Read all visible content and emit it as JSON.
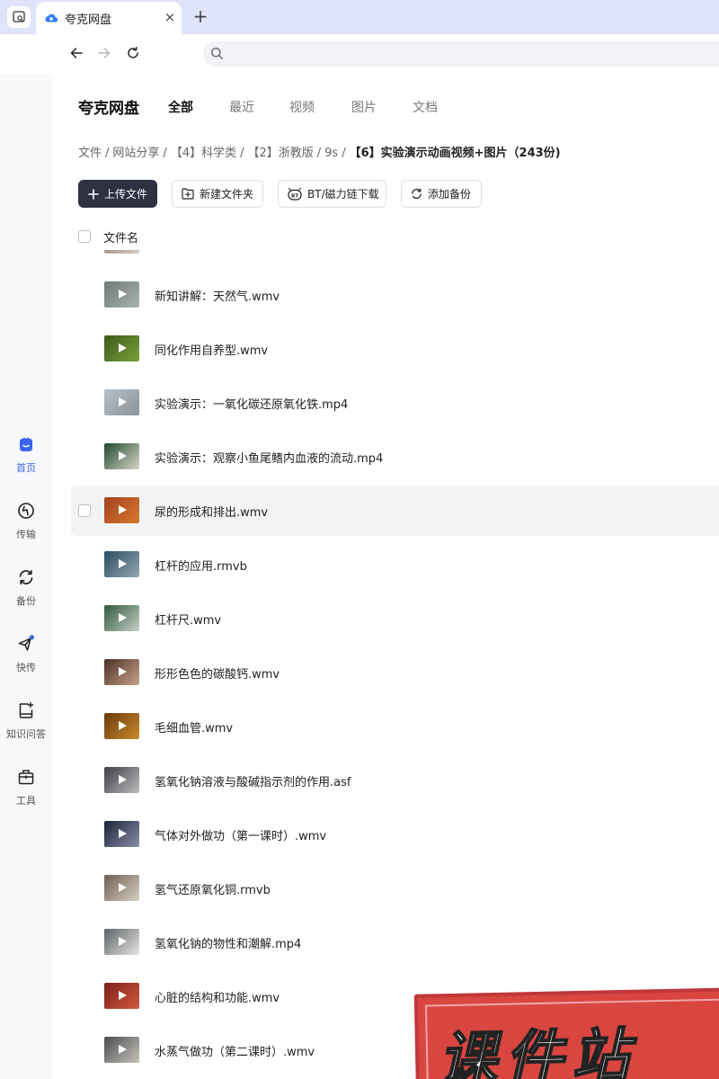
{
  "browser": {
    "tab_title": "夸克网盘",
    "tab_close": "×",
    "tab_new": "+",
    "url_placeholder": ""
  },
  "sidebar": {
    "items": [
      {
        "label": "首页",
        "icon": "home-face-icon",
        "active": true
      },
      {
        "label": "传输",
        "icon": "transfer-icon",
        "active": false
      },
      {
        "label": "备份",
        "icon": "backup-sync-icon",
        "active": false
      },
      {
        "label": "快传",
        "icon": "quick-send-plane-icon",
        "active": false
      },
      {
        "label": "知识问答",
        "icon": "knowledge-qa-icon",
        "active": false
      },
      {
        "label": "工具",
        "icon": "toolbox-icon",
        "active": false
      }
    ]
  },
  "header": {
    "title": "夸克网盘",
    "tabs": [
      {
        "label": "全部",
        "active": true
      },
      {
        "label": "最近",
        "active": false
      },
      {
        "label": "视频",
        "active": false
      },
      {
        "label": "图片",
        "active": false
      },
      {
        "label": "文档",
        "active": false
      }
    ]
  },
  "breadcrumb": {
    "items": [
      "文件",
      "网站分享",
      "【4】科学类",
      "【2】浙教版",
      "9s"
    ],
    "separator": "/",
    "current": "【6】实验演示动画视频+图片（243份)"
  },
  "actions": {
    "upload": "上传文件",
    "new_folder": "新建文件夹",
    "bt_download": "BT/磁力链下载",
    "add_backup": "添加备份"
  },
  "list": {
    "header_label": "文件名",
    "files": [
      {
        "name": "新知讲解：天然气.wmv",
        "thumb": [
          "#6f7a78",
          "#a9b3b0"
        ]
      },
      {
        "name": "同化作用自养型.wmv",
        "thumb": [
          "#3d5a1c",
          "#7aa03a"
        ]
      },
      {
        "name": "实验演示：一氧化碳还原氧化铁.mp4",
        "thumb": [
          "#b8c0c6",
          "#8a939a"
        ]
      },
      {
        "name": "实验演示：观察小鱼尾鳍内血液的流动.mp4",
        "thumb": [
          "#1f4a2e",
          "#d8d6c8"
        ]
      },
      {
        "name": "尿的形成和排出.wmv",
        "thumb": [
          "#a2401f",
          "#d9782f"
        ],
        "hover": true
      },
      {
        "name": "杠杆的应用.rmvb",
        "thumb": [
          "#2b4d63",
          "#95a7b1"
        ]
      },
      {
        "name": "杠杆尺.wmv",
        "thumb": [
          "#2f5a3d",
          "#c7cfc6"
        ]
      },
      {
        "name": "形形色色的碳酸钙.wmv",
        "thumb": [
          "#4a2e24",
          "#c9a48c"
        ]
      },
      {
        "name": "毛细血管.wmv",
        "thumb": [
          "#6b3a0d",
          "#c98a2b"
        ]
      },
      {
        "name": "氢氧化钠溶液与酸碱指示剂的作用.asf",
        "thumb": [
          "#3d3f42",
          "#b9bbbd"
        ]
      },
      {
        "name": "气体对外做功（第一课时）.wmv",
        "thumb": [
          "#1c2238",
          "#8a8fa8"
        ]
      },
      {
        "name": "氢气还原氧化铜.rmvb",
        "thumb": [
          "#6e5f52",
          "#d8cfc2"
        ]
      },
      {
        "name": "氢氧化钠的物性和潮解.mp4",
        "thumb": [
          "#5d6367",
          "#e7e6e2"
        ]
      },
      {
        "name": "心脏的结构和功能.wmv",
        "thumb": [
          "#7d1f1a",
          "#d35a3d"
        ]
      },
      {
        "name": "水蒸气做功（第二课时）.wmv",
        "thumb": [
          "#494c50",
          "#c8c3bb"
        ]
      }
    ]
  },
  "watermark": {
    "text": "课件站"
  },
  "colors": {
    "tabbar": "#dfe4fb",
    "primary_button": "#2d3142",
    "active_nav": "#3a62f0",
    "stamp": "#d8463f"
  }
}
